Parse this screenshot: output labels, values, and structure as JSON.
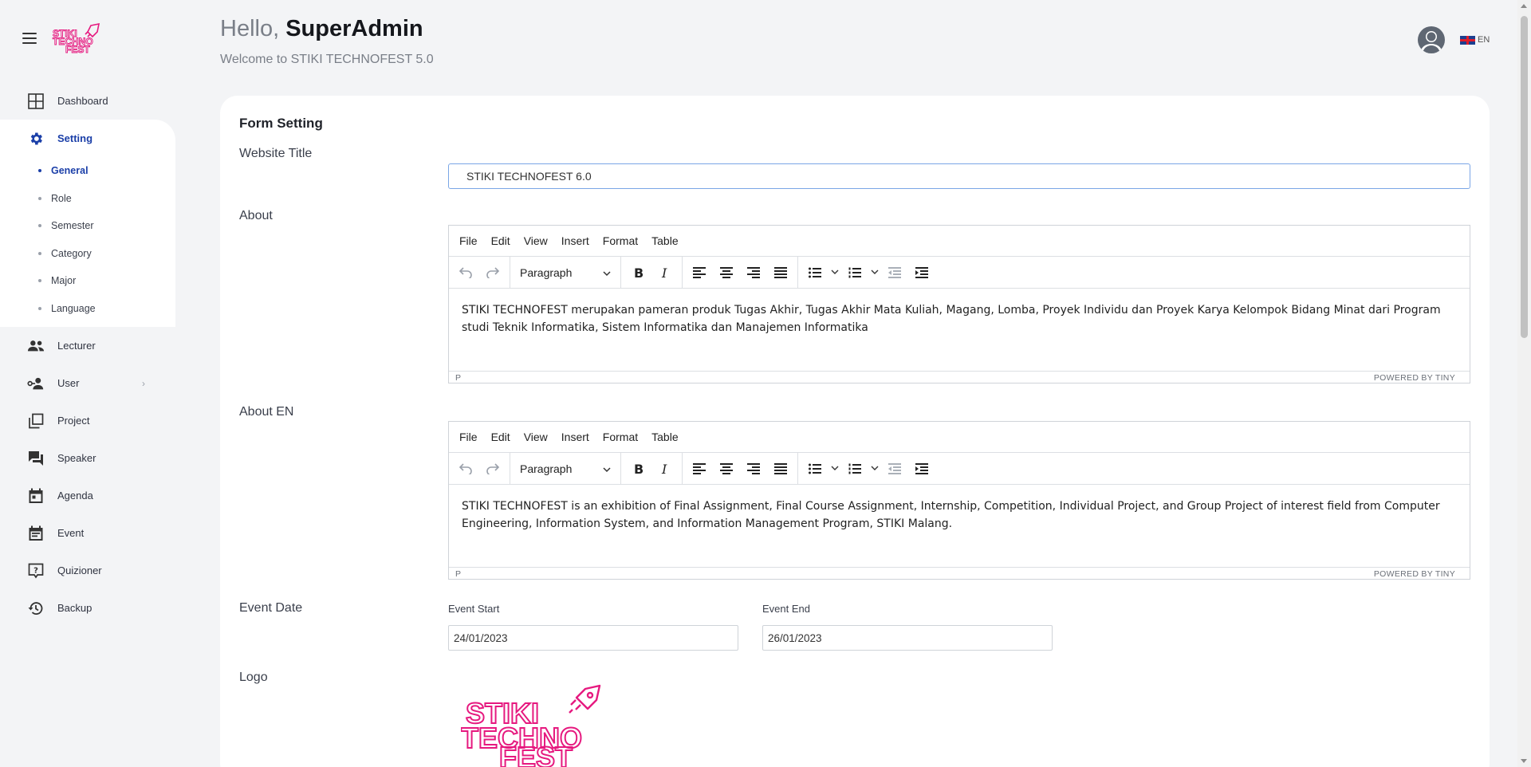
{
  "sidebar": {
    "logo_text": [
      "STIKI",
      "TECHNO",
      "FEST"
    ],
    "items": [
      {
        "label": "Dashboard",
        "icon": "grid-icon"
      },
      {
        "label": "Setting",
        "icon": "gear-icon"
      },
      {
        "label": "Lecturer",
        "icon": "people-icon"
      },
      {
        "label": "User",
        "icon": "user-key-icon"
      },
      {
        "label": "Project",
        "icon": "copy-icon"
      },
      {
        "label": "Speaker",
        "icon": "chat-icon"
      },
      {
        "label": "Agenda",
        "icon": "calendar-icon"
      },
      {
        "label": "Event",
        "icon": "calendar-list-icon"
      },
      {
        "label": "Quizioner",
        "icon": "question-icon"
      },
      {
        "label": "Backup",
        "icon": "restore-icon"
      }
    ],
    "setting_sub": [
      "General",
      "Role",
      "Semester",
      "Category",
      "Major",
      "Language"
    ],
    "active_sub": "General"
  },
  "header": {
    "greeting": "Hello,",
    "username": "SuperAdmin",
    "welcome": "Welcome to STIKI TECHNOFEST 5.0",
    "language": "EN"
  },
  "form": {
    "title": "Form Setting",
    "website_title_label": "Website Title",
    "website_title_value": "STIKI TECHNOFEST 6.0",
    "about_label": "About",
    "about_en_label": "About EN",
    "editor_menu": [
      "File",
      "Edit",
      "View",
      "Insert",
      "Format",
      "Table"
    ],
    "block_format": "Paragraph",
    "about_text": "STIKI TECHNOFEST merupakan pameran produk Tugas Akhir, Tugas Akhir Mata Kuliah, Magang, Lomba, Proyek Individu dan Proyek Karya Kelompok Bidang Minat dari Program studi Teknik Informatika, Sistem Informatika dan Manajemen Informatika",
    "about_en_text": "STIKI TECHNOFEST is an exhibition of Final Assignment, Final Course Assignment, Internship, Competition, Individual Project, and Group Project of interest field from Computer Engineering, Information System, and Information Management Program, STIKI Malang.",
    "status_path": "P",
    "powered_by": "POWERED BY TINY",
    "event_date_label": "Event Date",
    "event_start_label": "Event Start",
    "event_start_value": "24/01/2023",
    "event_end_label": "Event End",
    "event_end_value": "26/01/2023",
    "logo_label": "Logo"
  },
  "colors": {
    "brand": "#e6197f",
    "active": "#1b3fa8"
  }
}
